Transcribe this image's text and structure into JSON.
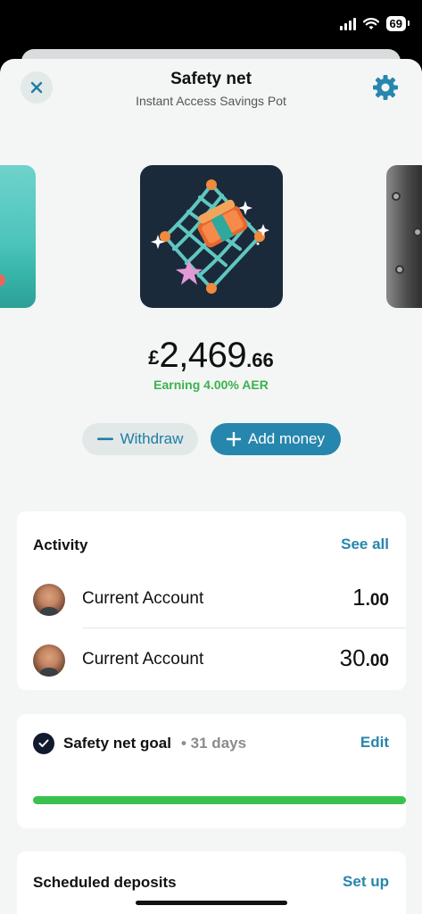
{
  "status_bar": {
    "time": "",
    "battery": "69"
  },
  "header": {
    "title": "Safety net",
    "subtitle": "Instant Access Savings Pot"
  },
  "balance": {
    "currency": "£",
    "major": "2,469",
    "minor": ".66",
    "earning": "Earning 4.00% AER"
  },
  "actions": {
    "withdraw_label": "Withdraw",
    "add_money_label": "Add money"
  },
  "activity": {
    "title": "Activity",
    "see_all": "See all",
    "items": [
      {
        "name": "Current Account",
        "amount_major": "1",
        "amount_minor": ".00"
      },
      {
        "name": "Current Account",
        "amount_major": "30",
        "amount_minor": ".00"
      }
    ]
  },
  "goal": {
    "title": "Safety net goal",
    "meta": "• 31 days",
    "edit": "Edit",
    "progress_fraction": 1.0
  },
  "scheduled": {
    "title": "Scheduled deposits",
    "action": "Set up"
  },
  "colors": {
    "accent": "#2786ad",
    "success": "#3ab24d",
    "progress": "#3ac24f"
  }
}
